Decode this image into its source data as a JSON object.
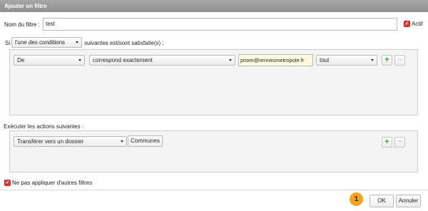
{
  "dialog": {
    "title": "Ajouter un filtre"
  },
  "filter_name": {
    "label": "Nom du filtre :",
    "value": "test"
  },
  "active": {
    "label": "Actif",
    "checked": true
  },
  "condition": {
    "prefix": "Si",
    "mode": "l'une des conditions",
    "suffix": "suivantes est/sont satisfaite(s) :"
  },
  "rule": {
    "field": "De",
    "operator": "correspond exactement",
    "value": "pnom@rennesmetropole.fr",
    "scope": "tout",
    "add": "+",
    "remove": "−"
  },
  "actions": {
    "heading": "Exécuter les actions suivantes :",
    "action": "Transférer vers un dossier",
    "folder": "Communes",
    "add": "+",
    "remove": "−"
  },
  "stop": {
    "label": "Ne pas appliquer d'autres filtres",
    "checked": true
  },
  "footer": {
    "badge": "1",
    "ok": "OK",
    "cancel": "Annuler"
  }
}
